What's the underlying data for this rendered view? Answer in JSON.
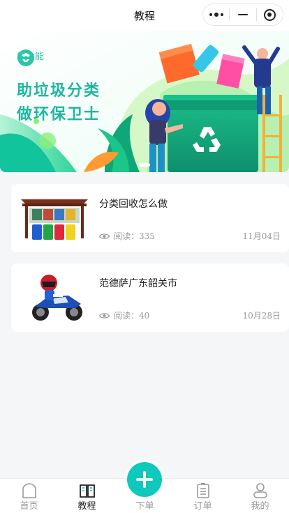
{
  "header": {
    "title": "教程"
  },
  "banner": {
    "brand_name": "纸全能",
    "slogan_line1": "助垃圾分类",
    "slogan_line2": "做环保卫士"
  },
  "articles": [
    {
      "title": "分类回收怎么做",
      "views_label": "阅读：",
      "views": "335",
      "date": "11月04日",
      "thumb_icon": "recycle-bins-image"
    },
    {
      "title": "范德萨广东韶关市",
      "views_label": "阅读：",
      "views": "40",
      "date": "10月28日",
      "thumb_icon": "motorcycle-image"
    }
  ],
  "tabbar": {
    "items": [
      {
        "label": "首页",
        "icon": "home-icon",
        "active": false
      },
      {
        "label": "教程",
        "icon": "book-icon",
        "active": true
      },
      {
        "label": "下单",
        "icon": "plus-icon",
        "active": false
      },
      {
        "label": "订单",
        "icon": "order-list-icon",
        "active": false
      },
      {
        "label": "我的",
        "icon": "user-icon",
        "active": false
      }
    ]
  },
  "colors": {
    "accent": "#10c9bd",
    "brand_green": "#1db7a0",
    "background": "#f5f6f8"
  }
}
